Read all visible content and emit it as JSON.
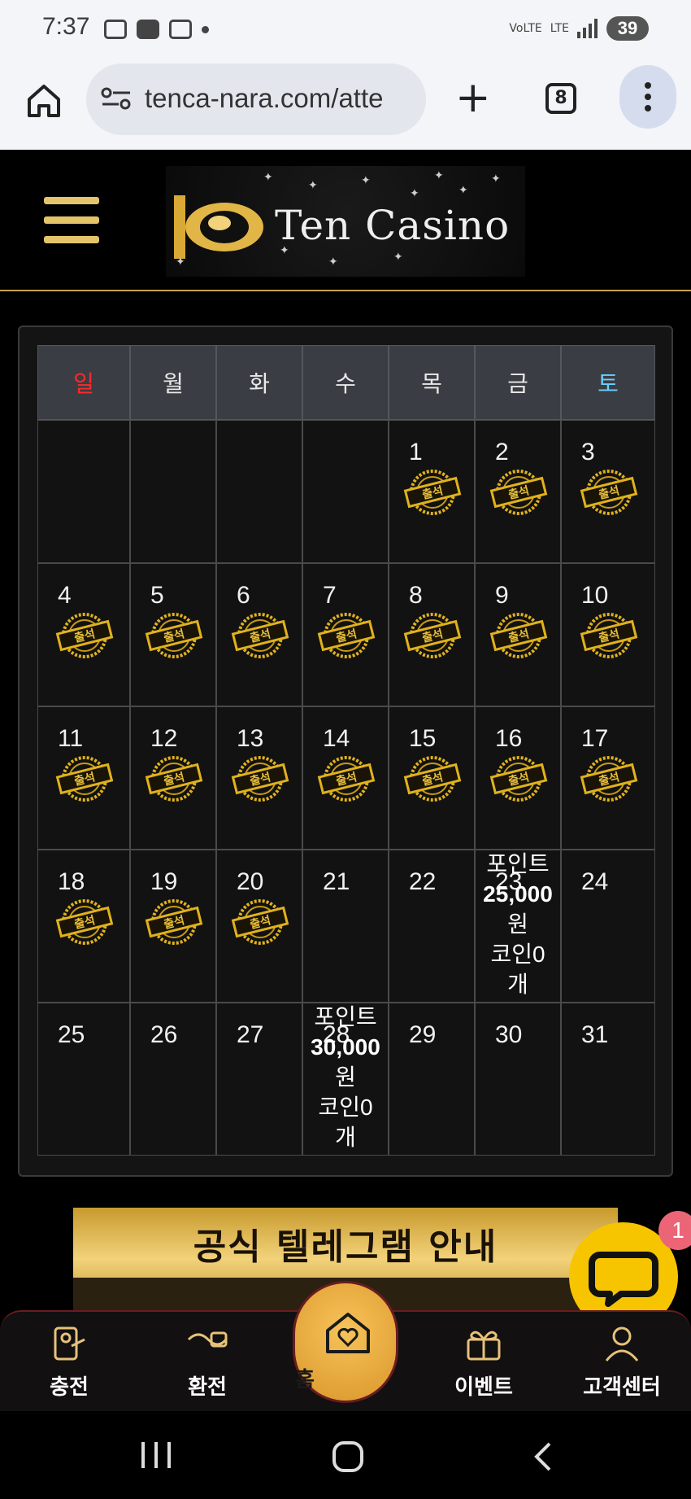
{
  "status_bar": {
    "time": "7:37",
    "battery": "39",
    "network": "LTE"
  },
  "browser": {
    "url": "tenca-nara.com/atte",
    "tab_count": "8"
  },
  "site": {
    "logo_text": "Ten Casino"
  },
  "calendar": {
    "weekdays": [
      "일",
      "월",
      "화",
      "수",
      "목",
      "금",
      "토"
    ],
    "weekday_colors": [
      "#ff2a2a",
      "#e9e9e9",
      "#e9e9e9",
      "#e9e9e9",
      "#e9e9e9",
      "#e9e9e9",
      "#6ad0ff"
    ],
    "stamp_label": "출석",
    "weeks": [
      [
        {
          "day": ""
        },
        {
          "day": ""
        },
        {
          "day": ""
        },
        {
          "day": ""
        },
        {
          "day": "1",
          "stamp": true
        },
        {
          "day": "2",
          "stamp": true
        },
        {
          "day": "3",
          "stamp": true
        }
      ],
      [
        {
          "day": "4",
          "stamp": true
        },
        {
          "day": "5",
          "stamp": true
        },
        {
          "day": "6",
          "stamp": true
        },
        {
          "day": "7",
          "stamp": true
        },
        {
          "day": "8",
          "stamp": true
        },
        {
          "day": "9",
          "stamp": true
        },
        {
          "day": "10",
          "stamp": true
        }
      ],
      [
        {
          "day": "11",
          "stamp": true
        },
        {
          "day": "12",
          "stamp": true
        },
        {
          "day": "13",
          "stamp": true
        },
        {
          "day": "14",
          "stamp": true
        },
        {
          "day": "15",
          "stamp": true
        },
        {
          "day": "16",
          "stamp": true
        },
        {
          "day": "17",
          "stamp": true
        }
      ],
      [
        {
          "day": "18",
          "stamp": true
        },
        {
          "day": "19",
          "stamp": true
        },
        {
          "day": "20",
          "stamp": true
        },
        {
          "day": "21"
        },
        {
          "day": "22"
        },
        {
          "day": "23",
          "reward": {
            "line1": "포인트",
            "line2": "25,000",
            "line3": "원",
            "line4": "코인0",
            "line5": "개"
          }
        },
        {
          "day": "24"
        }
      ],
      [
        {
          "day": "25"
        },
        {
          "day": "26"
        },
        {
          "day": "27"
        },
        {
          "day": "28",
          "reward": {
            "line1": "포인트",
            "line2": "30,000",
            "line3": "원",
            "line4": "코인0",
            "line5": "개"
          }
        },
        {
          "day": "29"
        },
        {
          "day": "30"
        },
        {
          "day": "31"
        }
      ]
    ]
  },
  "banner": {
    "title": "공식 텔레그램 안내"
  },
  "chat": {
    "badge": "1"
  },
  "bottom_nav": {
    "charge": "충전",
    "exchange": "환전",
    "home": "홈",
    "event": "이벤트",
    "support": "고객센터"
  }
}
